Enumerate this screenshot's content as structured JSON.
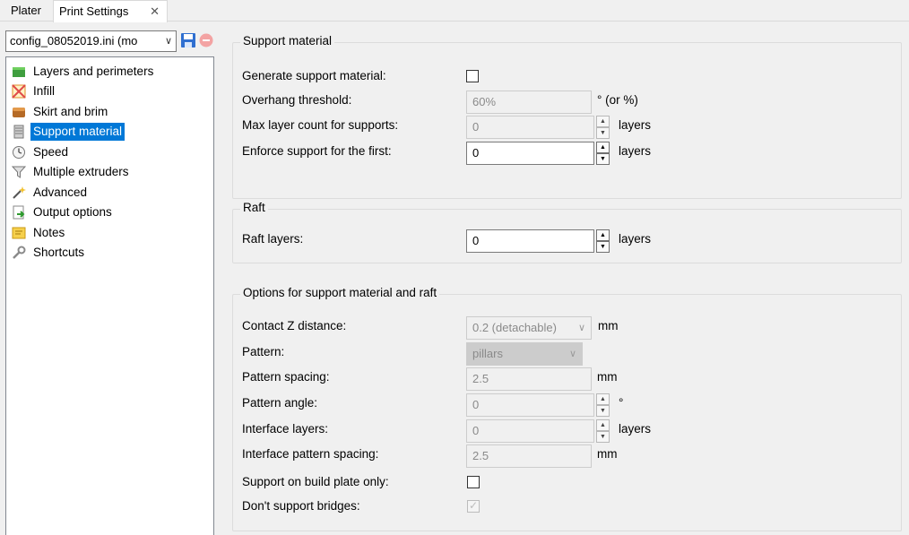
{
  "tabs": [
    {
      "label": "Plater"
    },
    {
      "label": "Print Settings"
    }
  ],
  "tab_close_glyph": "✕",
  "preset": {
    "value": "config_08052019.ini (mo",
    "chevron": "∨"
  },
  "tree": {
    "items": [
      {
        "label": "Layers and perimeters",
        "icon": "layers-icon"
      },
      {
        "label": "Infill",
        "icon": "infill-icon"
      },
      {
        "label": "Skirt and brim",
        "icon": "skirt-icon"
      },
      {
        "label": "Support material",
        "icon": "support-icon",
        "selected": true
      },
      {
        "label": "Speed",
        "icon": "speed-icon"
      },
      {
        "label": "Multiple extruders",
        "icon": "funnel-icon"
      },
      {
        "label": "Advanced",
        "icon": "wand-icon"
      },
      {
        "label": "Output options",
        "icon": "output-icon"
      },
      {
        "label": "Notes",
        "icon": "notes-icon"
      },
      {
        "label": "Shortcuts",
        "icon": "wrench-icon"
      }
    ]
  },
  "support": {
    "title": "Support material",
    "generate_label": "Generate support material:",
    "overhang_label": "Overhang threshold:",
    "overhang_value": "60%",
    "overhang_unit": "° (or %)",
    "max_layer_label": "Max layer count for supports:",
    "max_layer_value": "0",
    "max_layer_unit": "layers",
    "enforce_label": "Enforce support for the first:",
    "enforce_value": "0",
    "enforce_unit": "layers"
  },
  "raft": {
    "title": "Raft",
    "layers_label": "Raft layers:",
    "layers_value": "0",
    "layers_unit": "layers"
  },
  "options": {
    "title": "Options for support material and raft",
    "contact_label": "Contact Z distance:",
    "contact_value": "0.2 (detachable)",
    "contact_unit": "mm",
    "pattern_label": "Pattern:",
    "pattern_value": "pillars",
    "spacing_label": "Pattern spacing:",
    "spacing_value": "2.5",
    "spacing_unit": "mm",
    "angle_label": "Pattern angle:",
    "angle_value": "0",
    "angle_unit": "°",
    "interface_label": "Interface layers:",
    "interface_value": "0",
    "interface_unit": "layers",
    "interface_spacing_label": "Interface pattern spacing:",
    "interface_spacing_value": "2.5",
    "interface_spacing_unit": "mm",
    "buildplate_label": "Support on build plate only:",
    "bridges_label": "Don't support bridges:"
  },
  "glyphs": {
    "spin_up": "▲",
    "spin_down": "▼",
    "check": "✓",
    "combo_chevron": "∨"
  },
  "colors": {
    "selection": "#0078d7",
    "disabled_text": "#8a8a8a"
  }
}
